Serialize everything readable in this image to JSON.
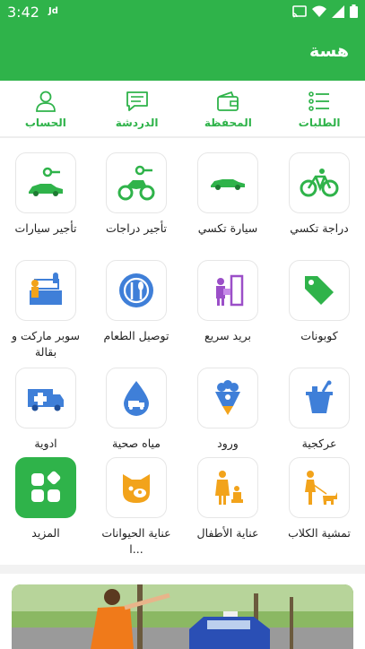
{
  "status_bar": {
    "time": "3:42",
    "carrier": "Jd"
  },
  "app_bar": {
    "title": "هسة"
  },
  "nav": [
    {
      "label": "الطلبات",
      "icon": "list-icon"
    },
    {
      "label": "المحفظة",
      "icon": "wallet-icon"
    },
    {
      "label": "الدردشة",
      "icon": "chat-icon"
    },
    {
      "label": "الحساب",
      "icon": "user-icon"
    }
  ],
  "services": [
    {
      "label": "دراجة تكسي",
      "icon": "bicycle-icon"
    },
    {
      "label": "سيارة تكسي",
      "icon": "car-icon"
    },
    {
      "label": "تأجير دراجات",
      "icon": "motorbike-key-icon"
    },
    {
      "label": "تأجير سيارات",
      "icon": "car-key-icon"
    },
    {
      "label": "كوبونات",
      "icon": "coupon-tag-icon"
    },
    {
      "label": "بريد سريع",
      "icon": "courier-icon"
    },
    {
      "label": "توصيل الطعام",
      "icon": "food-plate-icon"
    },
    {
      "label": "سوبر ماركت و بقالة",
      "icon": "grocery-store-icon"
    },
    {
      "label": "عركجية",
      "icon": "ice-bucket-icon"
    },
    {
      "label": "ورود",
      "icon": "flower-bouquet-icon"
    },
    {
      "label": "مياه صحية",
      "icon": "water-drop-truck-icon"
    },
    {
      "label": "ادوية",
      "icon": "ambulance-icon"
    },
    {
      "label": "تمشية الكلاب",
      "icon": "dog-walking-icon"
    },
    {
      "label": "عناية الأطفال",
      "icon": "childcare-icon"
    },
    {
      "label": "عناية الحيوانات ا...",
      "icon": "pet-care-icon"
    },
    {
      "label": "المزيد",
      "icon": "more-grid-icon"
    }
  ],
  "colors": {
    "brand": "#2fb34a",
    "blue": "#3f7fd8",
    "orange": "#f2a31b",
    "purple": "#9b4fc8"
  }
}
